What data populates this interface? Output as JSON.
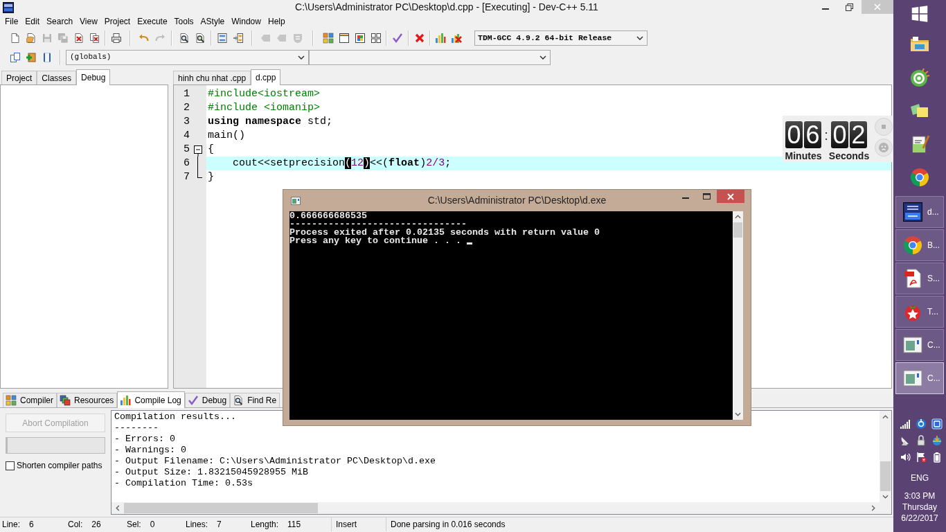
{
  "window": {
    "title": "C:\\Users\\Administrator PC\\Desktop\\d.cpp - [Executing] - Dev-C++ 5.11"
  },
  "menu": [
    "File",
    "Edit",
    "Search",
    "View",
    "Project",
    "Execute",
    "Tools",
    "AStyle",
    "Window",
    "Help"
  ],
  "toolbar": {
    "groups": [
      [
        {
          "disabled": false
        },
        {
          "disabled": false
        },
        {
          "disabled": true
        },
        {
          "disabled": true
        },
        {
          "disabled": false
        },
        {
          "disabled": false
        }
      ],
      [
        {
          "disabled": false
        }
      ],
      [
        {
          "disabled": false
        },
        {
          "disabled": true
        }
      ],
      [
        {
          "disabled": false
        },
        {
          "disabled": false
        }
      ],
      [
        {
          "disabled": false
        },
        {
          "disabled": false
        }
      ],
      [
        {
          "disabled": true
        },
        {
          "disabled": true
        },
        {
          "disabled": true
        }
      ],
      [
        {
          "disabled": false
        },
        {
          "disabled": false
        },
        {
          "disabled": false
        },
        {
          "disabled": false
        }
      ],
      [
        {
          "disabled": false
        }
      ],
      [
        {
          "disabled": false
        }
      ],
      [
        {
          "disabled": false
        },
        {
          "disabled": false
        }
      ]
    ],
    "compiler": "TDM-GCC 4.9.2 64-bit Release"
  },
  "toolbar_2": {
    "buttons": [
      {
        "disabled": false
      },
      {
        "disabled": false
      },
      {
        "disabled": false
      }
    ],
    "scope": "(globals)"
  },
  "left_panel": {
    "tabs": [
      {
        "label": "Project",
        "selected": false
      },
      {
        "label": "Classes",
        "selected": false
      },
      {
        "label": "Debug",
        "selected": true
      }
    ]
  },
  "editor": {
    "tabs": [
      {
        "label": "hinh chu nhat .cpp",
        "selected": false
      },
      {
        "label": "d.cpp",
        "selected": true
      }
    ],
    "lines": [
      {
        "number": "1",
        "current": false,
        "tokens": [
          {
            "text": "#include<iostream>",
            "kind": "preproc"
          }
        ]
      },
      {
        "number": "2",
        "current": false,
        "tokens": [
          {
            "text": "#include <iomanip>",
            "kind": "preproc"
          }
        ]
      },
      {
        "number": "3",
        "current": false,
        "tokens": [
          {
            "text": "using namespace",
            "kind": "keyword"
          },
          {
            "text": " std;",
            "kind": "plain"
          }
        ]
      },
      {
        "number": "4",
        "current": false,
        "tokens": [
          {
            "text": "main()",
            "kind": "plain"
          }
        ]
      },
      {
        "number": "5",
        "current": false,
        "fold": {
          "kind": "start",
          "expanded": true
        },
        "tokens": [
          {
            "text": "{",
            "kind": "plain"
          }
        ]
      },
      {
        "number": "6",
        "current": true,
        "fold": {
          "kind": "middle"
        },
        "tokens": [
          {
            "text": "    cout<<setprecision",
            "kind": "plain"
          },
          {
            "text": "(",
            "kind": "brace_match"
          },
          {
            "text": "12",
            "kind": "number"
          },
          {
            "text": ")",
            "kind": "brace_match"
          },
          {
            "text": "<<(",
            "kind": "plain"
          },
          {
            "text": "float",
            "kind": "keyword"
          },
          {
            "text": ")",
            "kind": "plain"
          },
          {
            "text": "2/3",
            "kind": "number"
          },
          {
            "text": ";",
            "kind": "plain"
          }
        ]
      },
      {
        "number": "7",
        "current": false,
        "fold": {
          "kind": "end"
        },
        "tokens": [
          {
            "text": "}",
            "kind": "plain"
          }
        ]
      }
    ]
  },
  "timer": {
    "minutes": [
      "0",
      "6"
    ],
    "separator": ":",
    "seconds": [
      "0",
      "2"
    ],
    "minutes_label": "Minutes",
    "seconds_label": "Seconds"
  },
  "bottom_panel": {
    "tabs": [
      {
        "label": "Compiler",
        "selected": false
      },
      {
        "label": "Resources",
        "selected": false
      },
      {
        "label": "Compile Log",
        "selected": true
      },
      {
        "label": "Debug",
        "selected": false
      },
      {
        "label": "Find Re",
        "selected": false
      }
    ],
    "abort_button": {
      "label": "Abort Compilation",
      "disabled": true
    },
    "progress": {
      "level": 0
    },
    "shorten_paths": {
      "label": "Shorten compiler paths",
      "checked": false
    },
    "log": [
      "Compilation results...",
      "--------",
      "- Errors: 0",
      "- Warnings: 0",
      "- Output Filename: C:\\Users\\Administrator PC\\Desktop\\d.exe",
      "- Output Size: 1.83215045928955 MiB",
      "- Compilation Time: 0.53s"
    ]
  },
  "status_bar": {
    "fields": [
      {
        "label": "Line:",
        "value": "6"
      },
      {
        "label": "Col:",
        "value": "26"
      },
      {
        "label": "Sel:",
        "value": "0"
      },
      {
        "label": "Lines:",
        "value": "7"
      },
      {
        "label": "Length:",
        "value": "115"
      }
    ],
    "mode": "Insert",
    "message": "Done parsing in 0.016 seconds"
  },
  "console": {
    "title": "C:\\Users\\Administrator PC\\Desktop\\d.exe",
    "lines": [
      "0.666666686535",
      "--------------------------------",
      "Process exited after 0.02135 seconds with return value 0",
      "Press any key to continue . . ."
    ],
    "cursor": true
  },
  "taskbar": {
    "windows": [
      {
        "label": "d...",
        "selected": false
      },
      {
        "label": "B...",
        "selected": false
      },
      {
        "label": "S...",
        "selected": false
      },
      {
        "label": "T...",
        "selected": false
      },
      {
        "label": "C...",
        "selected": false
      },
      {
        "label": "C...",
        "selected": true
      }
    ],
    "tray": {
      "language": "ENG",
      "time": "3:03 PM",
      "day": "Thursday",
      "date": "6/22/2017"
    }
  }
}
